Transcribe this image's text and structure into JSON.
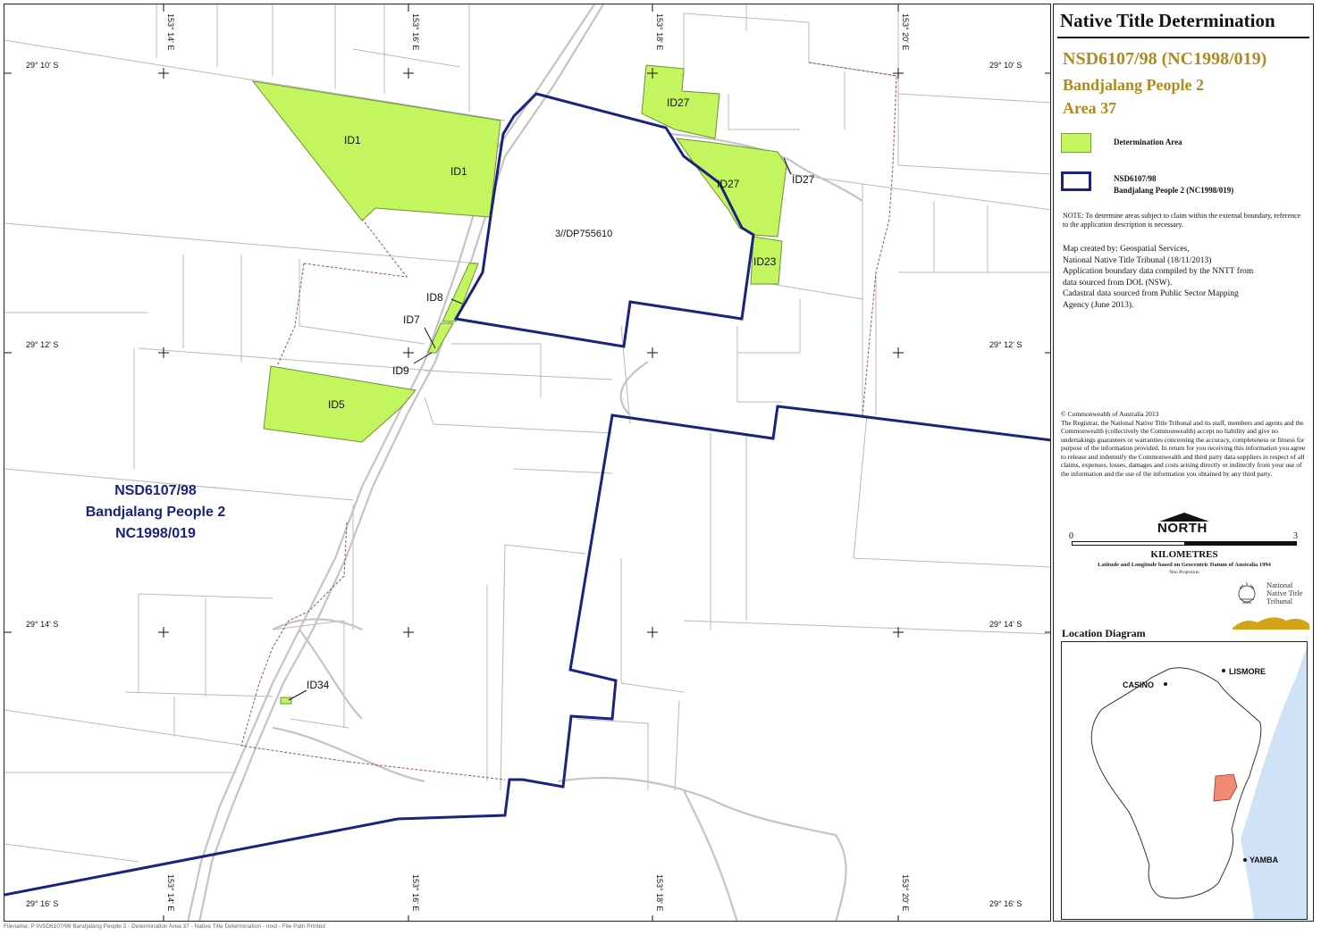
{
  "panel": {
    "title": "Native Title Determination",
    "app_number": "NSD6107/98 (NC1998/019)",
    "app_name": "Bandjalang People 2",
    "area_label": "Area 37"
  },
  "legend": {
    "determination_area": "Determination Area",
    "boundary_line1": "NSD6107/98",
    "boundary_line2": "Bandjalang People 2 (NC1998/019)"
  },
  "note": "NOTE: To determine areas subject to claim within the external boundary, reference to the application description is necessary.",
  "credits": [
    "Map created by: Geospatial Services,",
    "National Native Title Tribunal   (18/11/2013)",
    "Application boundary data compiled by the NNTT from",
    "data sourced from DOL (NSW).",
    "Cadastral data sourced from Public Sector Mapping",
    "Agency (June 2013)."
  ],
  "copyright": {
    "line1": "© Commonwealth of Australia 2013",
    "body": "The Registrar, the National Native Title Tribunal and its staff, members and agents and the Commonwealth (collectively the Commonwealth) accept no liability and give no undertakings guarantees or warranties concerning the accuracy, completeness or fitness for purpose of the information provided. In return for you receiving this information you agree to release and indemnify the Commonwealth and third party data suppliers in respect of all claims, expenses, losses, damages and costs arising directly or indirectly from your use of the information and the use of the information you obtained by any third party."
  },
  "north": "NORTH",
  "scale": {
    "min": "0",
    "max": "3",
    "unit": "KILOMETRES",
    "datum": "Latitude and Longitude based on Geocentric Datum of Australia 1994",
    "projection": "Non Projection"
  },
  "logo": {
    "line1": "National",
    "line2": "Native Title",
    "line3": "Tribunal"
  },
  "location": {
    "title": "Location Diagram",
    "towns": [
      "CASINO",
      "LISMORE",
      "YAMBA"
    ]
  },
  "map": {
    "lon_labels": [
      "153° 14' E",
      "153° 16' E",
      "153° 18' E",
      "153° 20' E"
    ],
    "lat_labels": [
      "29° 10' S",
      "29° 12' S",
      "29° 14' S",
      "29° 16' S"
    ],
    "parcel_labels": [
      "ID1",
      "ID1",
      "ID27",
      "ID27",
      "ID27",
      "ID23",
      "ID8",
      "ID7",
      "ID9",
      "ID5",
      "ID34"
    ],
    "lot_label": "3//DP755610",
    "claim_line1": "NSD6107/98",
    "claim_line2": "Bandjalang People 2",
    "claim_line3": "NC1998/019"
  },
  "colors": {
    "determination_fill": "#c2f55e",
    "boundary": "#1a237e",
    "title_gold": "#b08a1e",
    "ocean": "#cfe2f6",
    "area_marker": "#f08a72"
  },
  "footer": "Filename: P:\\NSD6107/98 Bandjalang People 2 - Determination Area 37 - Native Title Determination - mxd - File Path Printed"
}
